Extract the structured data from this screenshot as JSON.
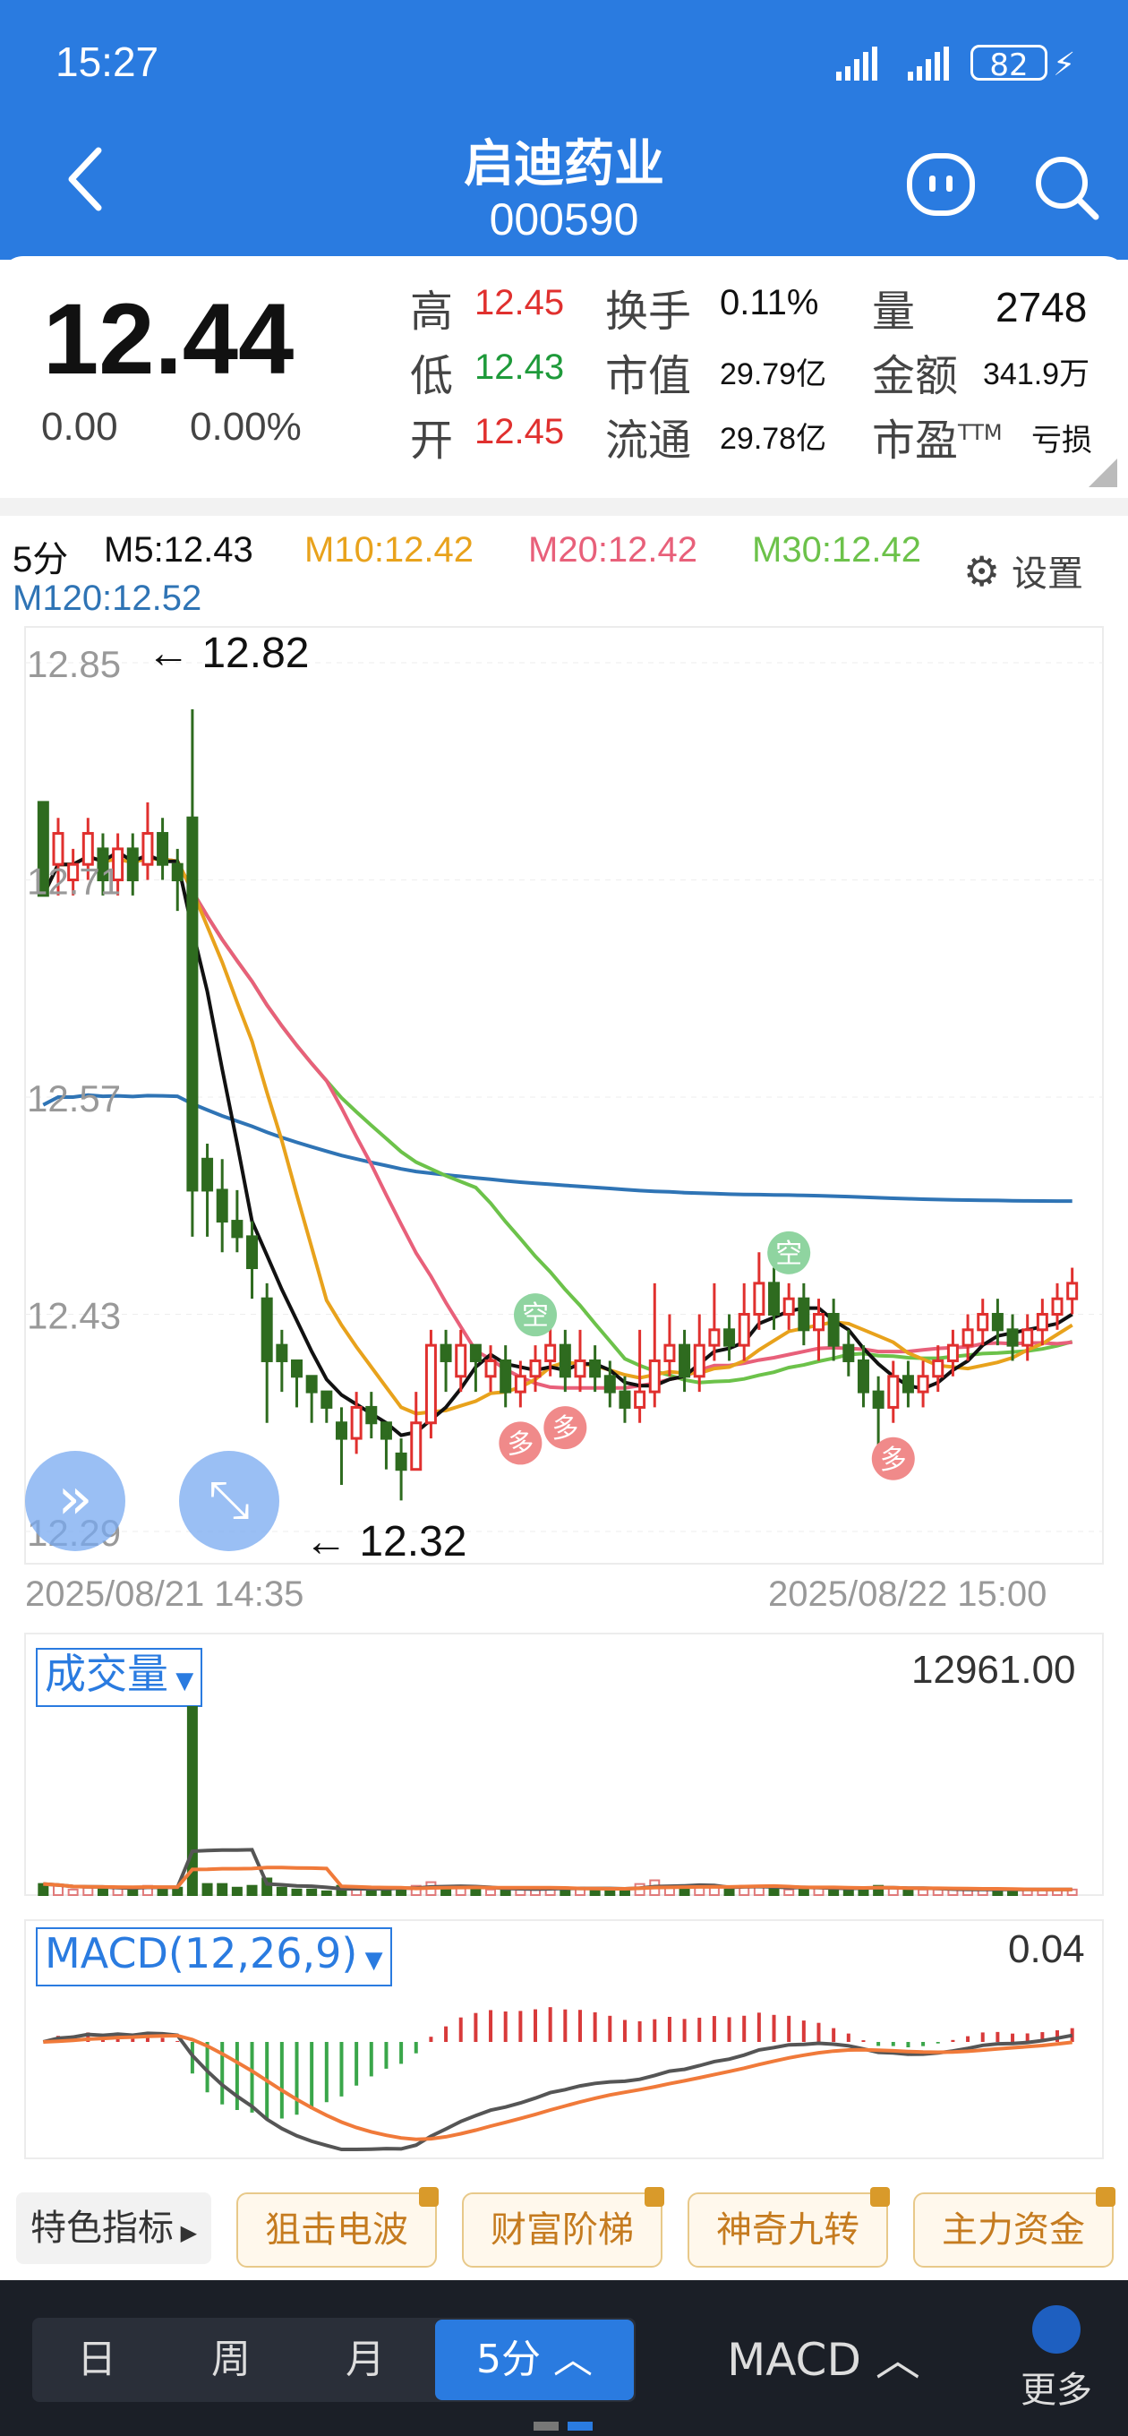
{
  "status_bar": {
    "time": "15:27",
    "battery": "82"
  },
  "header": {
    "name": "启迪药业",
    "code": "000590"
  },
  "quote": {
    "price": "12.44",
    "change": "0.00",
    "change_pct": "0.00%",
    "high_label": "高",
    "high": "12.45",
    "low_label": "低",
    "low": "12.43",
    "open_label": "开",
    "open": "12.45",
    "turnover_label": "换手",
    "turnover": "0.11%",
    "mktcap_label": "市值",
    "mktcap": "29.79亿",
    "float_label": "流通",
    "float_cap": "29.78亿",
    "volume_label": "量",
    "volume": "2748",
    "amount_label": "金额",
    "amount": "341.9万",
    "pe_label": "市盈",
    "pe_sup": "TTM",
    "pe": "亏损"
  },
  "ma_bar": {
    "period": "5分",
    "m5": "M5:12.43",
    "m10": "M10:12.42",
    "m20": "M20:12.42",
    "m30": "M30:12.42",
    "m120": "M120:12.52",
    "settings": "设置"
  },
  "colors": {
    "m5": "#111111",
    "m10": "#e8a21c",
    "m20": "#e8607a",
    "m30": "#6cc24a",
    "m120": "#2f74b5",
    "up": "#e0302e",
    "down": "#2e6b1f",
    "blue": "#2a7be0"
  },
  "chart_data": {
    "type": "candlestick",
    "y_ticks": [
      "12.85",
      "12.71",
      "12.57",
      "12.43",
      "12.29"
    ],
    "ylim": [
      12.29,
      12.85
    ],
    "x_start": "2025/08/21 14:35",
    "x_end": "2025/08/22 15:00",
    "high_annotation": "12.82",
    "low_annotation": "12.32",
    "candles": [
      [
        12.76,
        12.7,
        12.76,
        12.7
      ],
      [
        12.72,
        12.74,
        12.75,
        12.7
      ],
      [
        12.71,
        12.72,
        12.73,
        12.7
      ],
      [
        12.72,
        12.74,
        12.75,
        12.71
      ],
      [
        12.73,
        12.71,
        12.74,
        12.7
      ],
      [
        12.71,
        12.73,
        12.74,
        12.7
      ],
      [
        12.73,
        12.71,
        12.74,
        12.7
      ],
      [
        12.72,
        12.74,
        12.76,
        12.71
      ],
      [
        12.74,
        12.72,
        12.75,
        12.71
      ],
      [
        12.72,
        12.71,
        12.73,
        12.69
      ],
      [
        12.75,
        12.51,
        12.82,
        12.48
      ],
      [
        12.53,
        12.51,
        12.54,
        12.48
      ],
      [
        12.51,
        12.49,
        12.53,
        12.47
      ],
      [
        12.49,
        12.48,
        12.51,
        12.47
      ],
      [
        12.48,
        12.46,
        12.49,
        12.44
      ],
      [
        12.44,
        12.4,
        12.45,
        12.36
      ],
      [
        12.41,
        12.4,
        12.42,
        12.38
      ],
      [
        12.4,
        12.39,
        12.4,
        12.37
      ],
      [
        12.39,
        12.38,
        12.39,
        12.36
      ],
      [
        12.38,
        12.37,
        12.38,
        12.36
      ],
      [
        12.36,
        12.35,
        12.37,
        12.32
      ],
      [
        12.35,
        12.37,
        12.38,
        12.34
      ],
      [
        12.37,
        12.36,
        12.38,
        12.35
      ],
      [
        12.36,
        12.35,
        12.36,
        12.33
      ],
      [
        12.34,
        12.33,
        12.35,
        12.31
      ],
      [
        12.33,
        12.36,
        12.38,
        12.33
      ],
      [
        12.36,
        12.41,
        12.42,
        12.35
      ],
      [
        12.41,
        12.4,
        12.42,
        12.38
      ],
      [
        12.39,
        12.41,
        12.42,
        12.38
      ],
      [
        12.41,
        12.4,
        12.41,
        12.38
      ],
      [
        12.39,
        12.4,
        12.41,
        12.38
      ],
      [
        12.4,
        12.38,
        12.41,
        12.37
      ],
      [
        12.38,
        12.39,
        12.4,
        12.37
      ],
      [
        12.39,
        12.4,
        12.41,
        12.38
      ],
      [
        12.4,
        12.41,
        12.43,
        12.39
      ],
      [
        12.41,
        12.39,
        12.42,
        12.38
      ],
      [
        12.39,
        12.4,
        12.42,
        12.38
      ],
      [
        12.4,
        12.39,
        12.41,
        12.38
      ],
      [
        12.39,
        12.38,
        12.4,
        12.37
      ],
      [
        12.38,
        12.37,
        12.39,
        12.36
      ],
      [
        12.37,
        12.38,
        12.42,
        12.36
      ],
      [
        12.38,
        12.4,
        12.45,
        12.37
      ],
      [
        12.4,
        12.41,
        12.43,
        12.39
      ],
      [
        12.41,
        12.39,
        12.42,
        12.38
      ],
      [
        12.39,
        12.41,
        12.43,
        12.38
      ],
      [
        12.41,
        12.42,
        12.45,
        12.4
      ],
      [
        12.42,
        12.41,
        12.43,
        12.4
      ],
      [
        12.41,
        12.43,
        12.45,
        12.4
      ],
      [
        12.43,
        12.45,
        12.47,
        12.42
      ],
      [
        12.45,
        12.43,
        12.46,
        12.42
      ],
      [
        12.43,
        12.44,
        12.45,
        12.42
      ],
      [
        12.44,
        12.42,
        12.45,
        12.41
      ],
      [
        12.42,
        12.43,
        12.44,
        12.4
      ],
      [
        12.43,
        12.41,
        12.44,
        12.4
      ],
      [
        12.41,
        12.4,
        12.42,
        12.39
      ],
      [
        12.4,
        12.38,
        12.41,
        12.37
      ],
      [
        12.38,
        12.37,
        12.39,
        12.34
      ],
      [
        12.37,
        12.39,
        12.4,
        12.36
      ],
      [
        12.39,
        12.38,
        12.4,
        12.37
      ],
      [
        12.38,
        12.39,
        12.4,
        12.37
      ],
      [
        12.39,
        12.4,
        12.41,
        12.38
      ],
      [
        12.4,
        12.41,
        12.42,
        12.39
      ],
      [
        12.41,
        12.42,
        12.43,
        12.4
      ],
      [
        12.42,
        12.43,
        12.44,
        12.41
      ],
      [
        12.43,
        12.42,
        12.44,
        12.41
      ],
      [
        12.42,
        12.41,
        12.43,
        12.4
      ],
      [
        12.41,
        12.42,
        12.43,
        12.4
      ],
      [
        12.42,
        12.43,
        12.44,
        12.41
      ],
      [
        12.43,
        12.44,
        12.45,
        12.42
      ],
      [
        12.44,
        12.45,
        12.46,
        12.43
      ]
    ],
    "signals": [
      {
        "label": "空",
        "kind": "short",
        "index": 33
      },
      {
        "label": "多",
        "kind": "long",
        "index": 32
      },
      {
        "label": "多",
        "kind": "long",
        "index": 35
      },
      {
        "label": "空",
        "kind": "short",
        "index": 50
      },
      {
        "label": "多",
        "kind": "long",
        "index": 57
      }
    ]
  },
  "volume_panel": {
    "label": "成交量",
    "value": "12961.00"
  },
  "macd_panel": {
    "label": "MACD(12,26,9)",
    "value": "0.04"
  },
  "indicator_chips": {
    "special": "特色指标",
    "items": [
      "狙击电波",
      "财富阶梯",
      "神奇九转",
      "主力资金"
    ]
  },
  "bottom_bar": {
    "periods": [
      "日",
      "周",
      "月",
      "5分"
    ],
    "indicator": "MACD",
    "more": "更多"
  }
}
